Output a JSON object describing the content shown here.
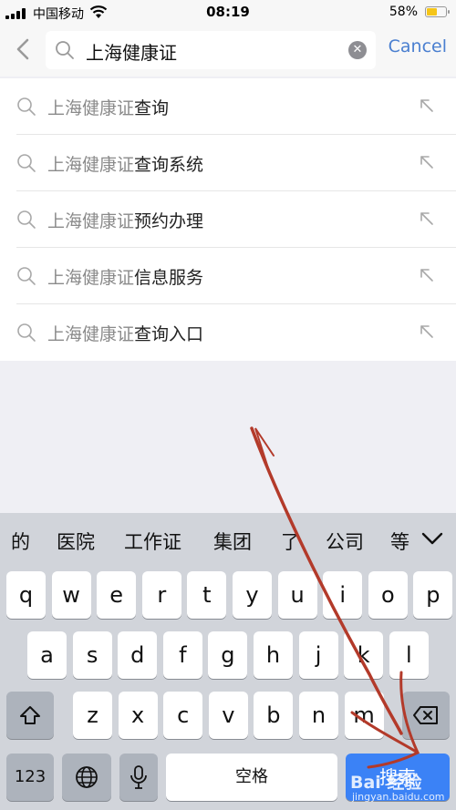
{
  "status_bar": {
    "carrier": "中国移动",
    "time": "08:19",
    "battery": "58%",
    "battery_level": 0.58
  },
  "search": {
    "query": "上海健康证",
    "cancel_label": "Cancel"
  },
  "suggestions": [
    {
      "prefix": "上海健康证",
      "suffix": "查询"
    },
    {
      "prefix": "上海健康证",
      "suffix": "查询系统"
    },
    {
      "prefix": "上海健康证",
      "suffix": "预约办理"
    },
    {
      "prefix": "上海健康证",
      "suffix": "信息服务"
    },
    {
      "prefix": "上海健康证",
      "suffix": "查询入口"
    }
  ],
  "keyboard": {
    "candidates": [
      "的",
      "医院",
      "工作证",
      "集团",
      "了",
      "公司",
      "等"
    ],
    "row1": [
      "q",
      "w",
      "e",
      "r",
      "t",
      "y",
      "u",
      "i",
      "o",
      "p"
    ],
    "row2": [
      "a",
      "s",
      "d",
      "f",
      "g",
      "h",
      "j",
      "k",
      "l"
    ],
    "row3": [
      "z",
      "x",
      "c",
      "v",
      "b",
      "n",
      "m"
    ],
    "numbers_label": "123",
    "space_label": "空格",
    "search_label": "搜索"
  },
  "watermark": {
    "line1": "Bai 经验",
    "line2": "jingyan.baidu.com"
  },
  "colors": {
    "accent": "#4a7fd0",
    "key_blue": "#3b82f6",
    "arrow": "#b33a2a"
  }
}
